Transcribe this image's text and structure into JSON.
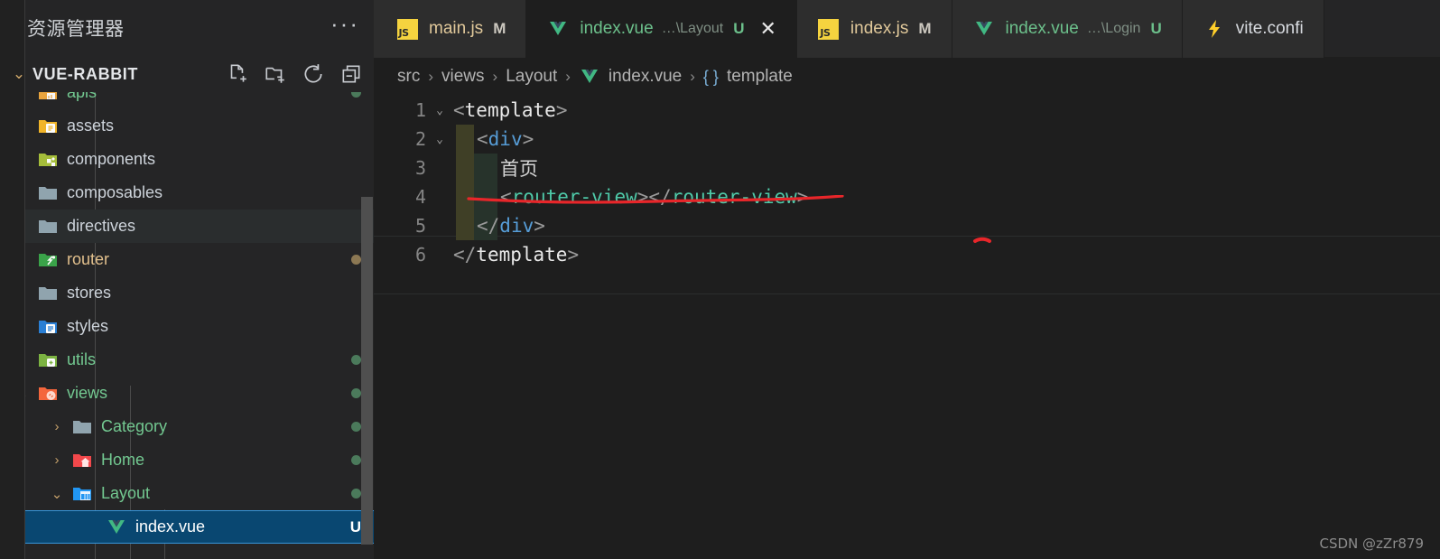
{
  "sidebar": {
    "title": "资源管理器",
    "more_label": "···",
    "root": {
      "label": "VUE-RABBIT",
      "chevron": "⌄"
    },
    "actions": [
      {
        "name": "new-file-icon",
        "tooltip": "新建文件"
      },
      {
        "name": "new-folder-icon",
        "tooltip": "新建文件夹"
      },
      {
        "name": "refresh-icon",
        "tooltip": "刷新资源管理器"
      },
      {
        "name": "collapse-all-icon",
        "tooltip": "在资源管理器中折叠文件夹"
      }
    ],
    "tree": [
      {
        "label": "apis",
        "icon": "folder-api",
        "chevron": "›",
        "indent": 1,
        "color": "new",
        "badge": "",
        "dot": "green",
        "state": "clipped"
      },
      {
        "label": "assets",
        "icon": "folder-assets",
        "chevron": "›",
        "indent": 1,
        "color": "default",
        "badge": "",
        "dot": "",
        "state": "normal"
      },
      {
        "label": "components",
        "icon": "folder-components",
        "chevron": "›",
        "indent": 1,
        "color": "default",
        "badge": "",
        "dot": "",
        "state": "normal"
      },
      {
        "label": "composables",
        "icon": "folder-plain",
        "chevron": "›",
        "indent": 1,
        "color": "default",
        "badge": "",
        "dot": "",
        "state": "normal"
      },
      {
        "label": "directives",
        "icon": "folder-plain",
        "chevron": "›",
        "indent": 1,
        "color": "default",
        "badge": "",
        "dot": "",
        "state": "hovered"
      },
      {
        "label": "router",
        "icon": "folder-router",
        "chevron": "›",
        "indent": 1,
        "color": "mod",
        "badge": "",
        "dot": "mod",
        "state": "normal"
      },
      {
        "label": "stores",
        "icon": "folder-plain",
        "chevron": "›",
        "indent": 1,
        "color": "default",
        "badge": "",
        "dot": "",
        "state": "normal"
      },
      {
        "label": "styles",
        "icon": "folder-styles",
        "chevron": "›",
        "indent": 1,
        "color": "default",
        "badge": "",
        "dot": "",
        "state": "normal"
      },
      {
        "label": "utils",
        "icon": "folder-utils",
        "chevron": "›",
        "indent": 1,
        "color": "new",
        "badge": "",
        "dot": "green",
        "state": "normal"
      },
      {
        "label": "views",
        "icon": "folder-views",
        "chevron": "⌄",
        "indent": 1,
        "color": "new",
        "badge": "",
        "dot": "green",
        "state": "normal"
      },
      {
        "label": "Category",
        "icon": "folder-plain",
        "chevron": "›",
        "indent": 2,
        "color": "new",
        "badge": "",
        "dot": "green",
        "state": "normal"
      },
      {
        "label": "Home",
        "icon": "folder-home",
        "chevron": "›",
        "indent": 2,
        "color": "new",
        "badge": "",
        "dot": "green",
        "state": "normal"
      },
      {
        "label": "Layout",
        "icon": "folder-layout",
        "chevron": "⌄",
        "indent": 2,
        "color": "new",
        "badge": "",
        "dot": "green",
        "state": "normal"
      },
      {
        "label": "index.vue",
        "icon": "vue-file",
        "chevron": "",
        "indent": 3,
        "color": "sel",
        "badge": "U",
        "dot": "",
        "state": "selected"
      }
    ]
  },
  "tabs": [
    {
      "name": "main.js",
      "icon": "js-icon",
      "sub": "",
      "flag": "M",
      "flag_kind": "m",
      "active": false,
      "closable": false,
      "name_kind": "js"
    },
    {
      "name": "index.vue",
      "icon": "vue-icon",
      "sub": "…\\Layout",
      "flag": "U",
      "flag_kind": "u",
      "active": true,
      "closable": true,
      "name_kind": "vue"
    },
    {
      "name": "index.js",
      "icon": "js-icon",
      "sub": "",
      "flag": "M",
      "flag_kind": "m",
      "active": false,
      "closable": false,
      "name_kind": "js"
    },
    {
      "name": "index.vue",
      "icon": "vue-icon",
      "sub": "…\\Login",
      "flag": "U",
      "flag_kind": "u",
      "active": false,
      "closable": false,
      "name_kind": "vue"
    },
    {
      "name": "vite.confi",
      "icon": "vite-icon",
      "sub": "",
      "flag": "",
      "flag_kind": "m",
      "active": false,
      "closable": false,
      "name_kind": "cfg"
    }
  ],
  "breadcrumb": {
    "separator": "›",
    "items": [
      {
        "label": "src",
        "icon": ""
      },
      {
        "label": "views",
        "icon": ""
      },
      {
        "label": "Layout",
        "icon": ""
      },
      {
        "label": "index.vue",
        "icon": "vue-icon"
      },
      {
        "label": "template",
        "icon": "braces-icon"
      }
    ],
    "braces": "{ }"
  },
  "code": {
    "lines": [
      {
        "num": "1",
        "fold": "⌄",
        "indent": 0,
        "tokens": [
          {
            "t": "<",
            "c": "punc"
          },
          {
            "t": "template",
            "c": "tag"
          },
          {
            "t": ">",
            "c": "punc"
          }
        ]
      },
      {
        "num": "2",
        "fold": "⌄",
        "indent": 1,
        "tokens": [
          {
            "t": "<",
            "c": "punc"
          },
          {
            "t": "div",
            "c": "blue"
          },
          {
            "t": ">",
            "c": "punc"
          }
        ]
      },
      {
        "num": "3",
        "fold": "",
        "indent": 2,
        "tokens": [
          {
            "t": "首页",
            "c": "text"
          }
        ]
      },
      {
        "num": "4",
        "fold": "",
        "indent": 2,
        "tokens": [
          {
            "t": "<",
            "c": "punc"
          },
          {
            "t": "router-view",
            "c": "comp"
          },
          {
            "t": ">",
            "c": "punc"
          },
          {
            "t": "</",
            "c": "punc"
          },
          {
            "t": "router-view",
            "c": "comp"
          },
          {
            "t": ">",
            "c": "punc"
          }
        ]
      },
      {
        "num": "5",
        "fold": "",
        "indent": 1,
        "tokens": [
          {
            "t": "</",
            "c": "punc"
          },
          {
            "t": "div",
            "c": "blue"
          },
          {
            "t": ">",
            "c": "punc"
          }
        ]
      },
      {
        "num": "6",
        "fold": "",
        "indent": 0,
        "tokens": [
          {
            "t": "</",
            "c": "punc"
          },
          {
            "t": "template",
            "c": "tag"
          },
          {
            "t": ">",
            "c": "punc"
          }
        ]
      }
    ]
  },
  "annotations": {
    "underline_color": "#e8262a",
    "underline_target": "router-view"
  },
  "watermark": "CSDN @zZr879"
}
